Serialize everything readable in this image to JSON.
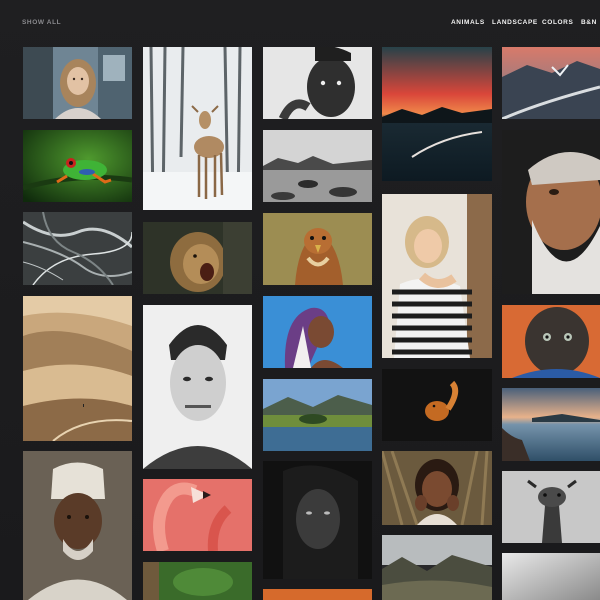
{
  "filters": {
    "show_all": "SHOW ALL",
    "animals": "ANIMALS",
    "landscape": "LANDSCAPE",
    "colors": "COLORS",
    "bn": "B&N"
  },
  "colors": {
    "background": "#1c1c1e",
    "filter_inactive": "#8a8a8e",
    "filter_active": "#f2f2f2"
  }
}
